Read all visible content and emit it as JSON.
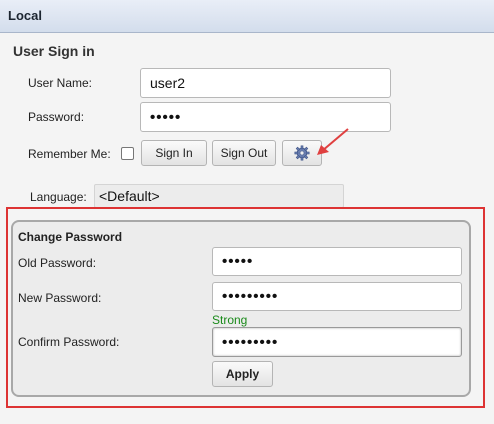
{
  "header": {
    "title": "Local"
  },
  "signin": {
    "title": "User Sign in",
    "username_label": "User Name:",
    "username_value": "user2",
    "password_label": "Password:",
    "password_value": "•••••",
    "remember_label": "Remember Me:",
    "remember_checked": false,
    "sign_in_label": "Sign In",
    "sign_out_label": "Sign Out",
    "settings_icon": "gear-icon",
    "language_label": "Language:",
    "language_value": "<Default>"
  },
  "change_password": {
    "title": "Change Password",
    "old_label": "Old Password:",
    "old_value": "•••••",
    "new_label": "New Password:",
    "new_value": "•••••••••",
    "strength": "Strong",
    "strength_color": "#1a8a1a",
    "confirm_label": "Confirm Password:",
    "confirm_value": "•••••••••",
    "apply_label": "Apply"
  },
  "colors": {
    "highlight_frame": "#dd3333",
    "annotation_arrow": "#e04040"
  }
}
